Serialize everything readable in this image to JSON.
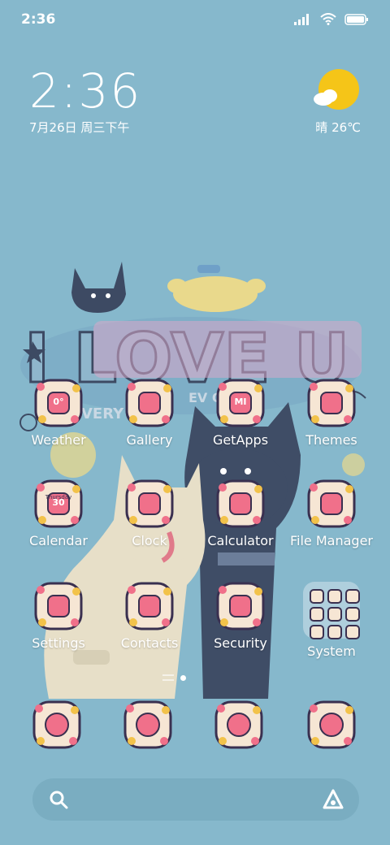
{
  "status_bar": {
    "time": "2:36",
    "icons": [
      "signal-icon",
      "wifi-icon",
      "battery-icon"
    ]
  },
  "clock_widget": {
    "time": "2:36",
    "date": "7月26日 周三下午"
  },
  "weather_widget": {
    "condition_icon": "sun-cloud-icon",
    "text": "晴 26℃"
  },
  "wallpaper": {
    "headline": "I LOVE U",
    "subtext_left": "VERY",
    "subtext_right": "EV   OME"
  },
  "apps": [
    {
      "label": "Weather",
      "icon": "weather-icon",
      "badge": "0°"
    },
    {
      "label": "Gallery",
      "icon": "gallery-icon"
    },
    {
      "label": "GetApps",
      "icon": "getapps-icon",
      "badge": "MI"
    },
    {
      "label": "Themes",
      "icon": "themes-icon"
    },
    {
      "label": "Calendar",
      "icon": "calendar-icon",
      "badge_top": "Thursday",
      "badge": "30"
    },
    {
      "label": "Clock",
      "icon": "clock-icon"
    },
    {
      "label": "Calculator",
      "icon": "calculator-icon"
    },
    {
      "label": "File Manager",
      "icon": "folder-icon"
    },
    {
      "label": "Settings",
      "icon": "settings-icon"
    },
    {
      "label": "Contacts",
      "icon": "contacts-icon"
    },
    {
      "label": "Security",
      "icon": "security-icon"
    },
    {
      "label": "System",
      "icon": "system-folder-icon"
    }
  ],
  "dock": [
    {
      "icon": "phone-icon"
    },
    {
      "icon": "messages-icon"
    },
    {
      "icon": "browser-icon"
    },
    {
      "icon": "camera-icon"
    }
  ],
  "page_indicator": {
    "pages": 2,
    "current": 2
  },
  "colors": {
    "background": "#86b8cc",
    "icon_frame": "#3a3050",
    "icon_fill": "#f6e6d4",
    "accent_pink": "#f0708a"
  }
}
